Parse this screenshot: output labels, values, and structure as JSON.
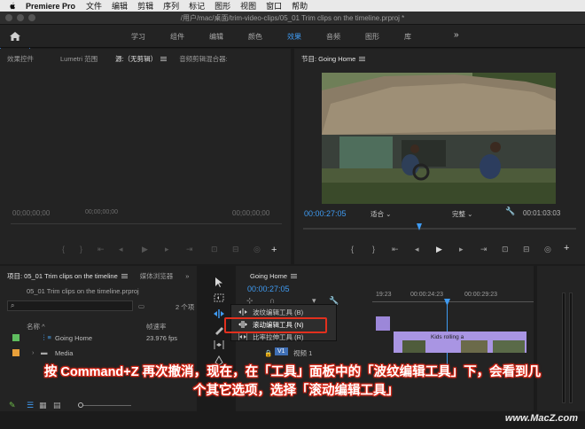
{
  "menubar": {
    "app": "Premiere Pro",
    "items": [
      "文件",
      "编辑",
      "剪辑",
      "序列",
      "标记",
      "图形",
      "视图",
      "窗口",
      "帮助"
    ]
  },
  "titlebar": {
    "path": "/用户/mac/桌面/trim-video-clips/05_01 Trim clips on the timeline.prproj *"
  },
  "workspaces": {
    "tabs": [
      "学习",
      "组件",
      "编辑",
      "颜色",
      "效果",
      "音频",
      "图形",
      "库"
    ],
    "active_index": 4,
    "more": "»"
  },
  "source_panel": {
    "tabs": [
      "效果控件",
      "Lumetri 范围",
      "源:（无剪辑）",
      "音频剪辑混合器:"
    ],
    "active_index": 2,
    "timecode_left": "00;00;00;00",
    "timecode_center": "00;00;00;00",
    "timecode_right": "00;00;00;00"
  },
  "program_panel": {
    "title": "节目: Going Home",
    "timecode": "00:00:27:05",
    "fit": "适合",
    "quality": "完整",
    "duration": "00:01:03:03"
  },
  "project_panel": {
    "tabs": [
      "项目: 05_01 Trim clips on the timeline",
      "媒体浏览器"
    ],
    "more": "»",
    "file": "05_01 Trim clips on the timeline.prproj",
    "item_count": "2 个项",
    "columns": [
      "名称",
      "帧速率"
    ],
    "rows": [
      {
        "name": "Going Home",
        "rate": "23.976 fps",
        "color": "#5fbd5f"
      },
      {
        "name": "Media",
        "rate": "",
        "color": "#e8a03a"
      }
    ]
  },
  "timeline_panel": {
    "tab": "Going Home",
    "timecode": "00:00:27:05",
    "ruler": [
      "19:23",
      "00:00:24:23",
      "00:00:29:23"
    ],
    "track_v1": "V1",
    "track_label": "视频 1",
    "clip_label": "Kids rolling a"
  },
  "popup_menu": {
    "items": [
      {
        "label": "波纹编辑工具 (B)"
      },
      {
        "label": "滚动编辑工具 (N)"
      },
      {
        "label": "比率拉伸工具 (R)"
      }
    ]
  },
  "caption": {
    "line1": "按 Command+Z 再次撤消，现在，在「工具」面板中的「波纹编辑工具」下，会看到几",
    "line2": "个其它选项，选择「滚动编辑工具」"
  },
  "watermark": "www.MacZ.com",
  "colors": {
    "accent": "#3f9bf2",
    "highlight": "#e2301e",
    "clip_purple": "#9c87d9"
  }
}
